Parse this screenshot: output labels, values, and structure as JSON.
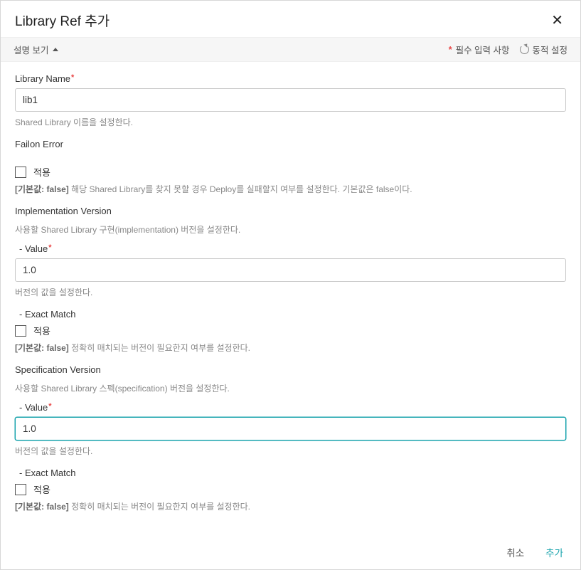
{
  "dialog": {
    "title": "Library Ref 추가",
    "close": "✕"
  },
  "toolbar": {
    "show_desc": "설명 보기",
    "legend_required": "필수 입력 사항",
    "legend_dynamic": "동적 설정"
  },
  "libraryName": {
    "label": "Library Name",
    "value": "lib1",
    "help": "Shared Library 이름을 설정한다."
  },
  "failOnError": {
    "title": "Failon Error",
    "apply": "적용",
    "help_prefix": "[기본값: false] ",
    "help_body": "해당 Shared Library를 찾지 못할 경우 Deploy를 실패할지 여부를 설정한다. 기본값은 false이다."
  },
  "implVersion": {
    "title": "Implementation Version",
    "desc": "사용할 Shared Library 구현(implementation) 버전을 설정한다.",
    "valueLabel": "- Value",
    "value": "1.0",
    "valueHelp": "버전의 값을 설정한다.",
    "exactMatchLabel": "- Exact Match",
    "apply": "적용",
    "help_prefix": "[기본값: false] ",
    "help_body": "정확히 매치되는 버전이 필요한지 여부를 설정한다."
  },
  "specVersion": {
    "title": "Specification Version",
    "desc": "사용할 Shared Library 스펙(specification) 버전을 설정한다.",
    "valueLabel": "- Value",
    "value": "1.0",
    "valueHelp": "버전의 값을 설정한다.",
    "exactMatchLabel": "- Exact Match",
    "apply": "적용",
    "help_prefix": "[기본값: false] ",
    "help_body": "정확히 매치되는 버전이 필요한지 여부를 설정한다."
  },
  "footer": {
    "cancel": "취소",
    "submit": "추가"
  }
}
